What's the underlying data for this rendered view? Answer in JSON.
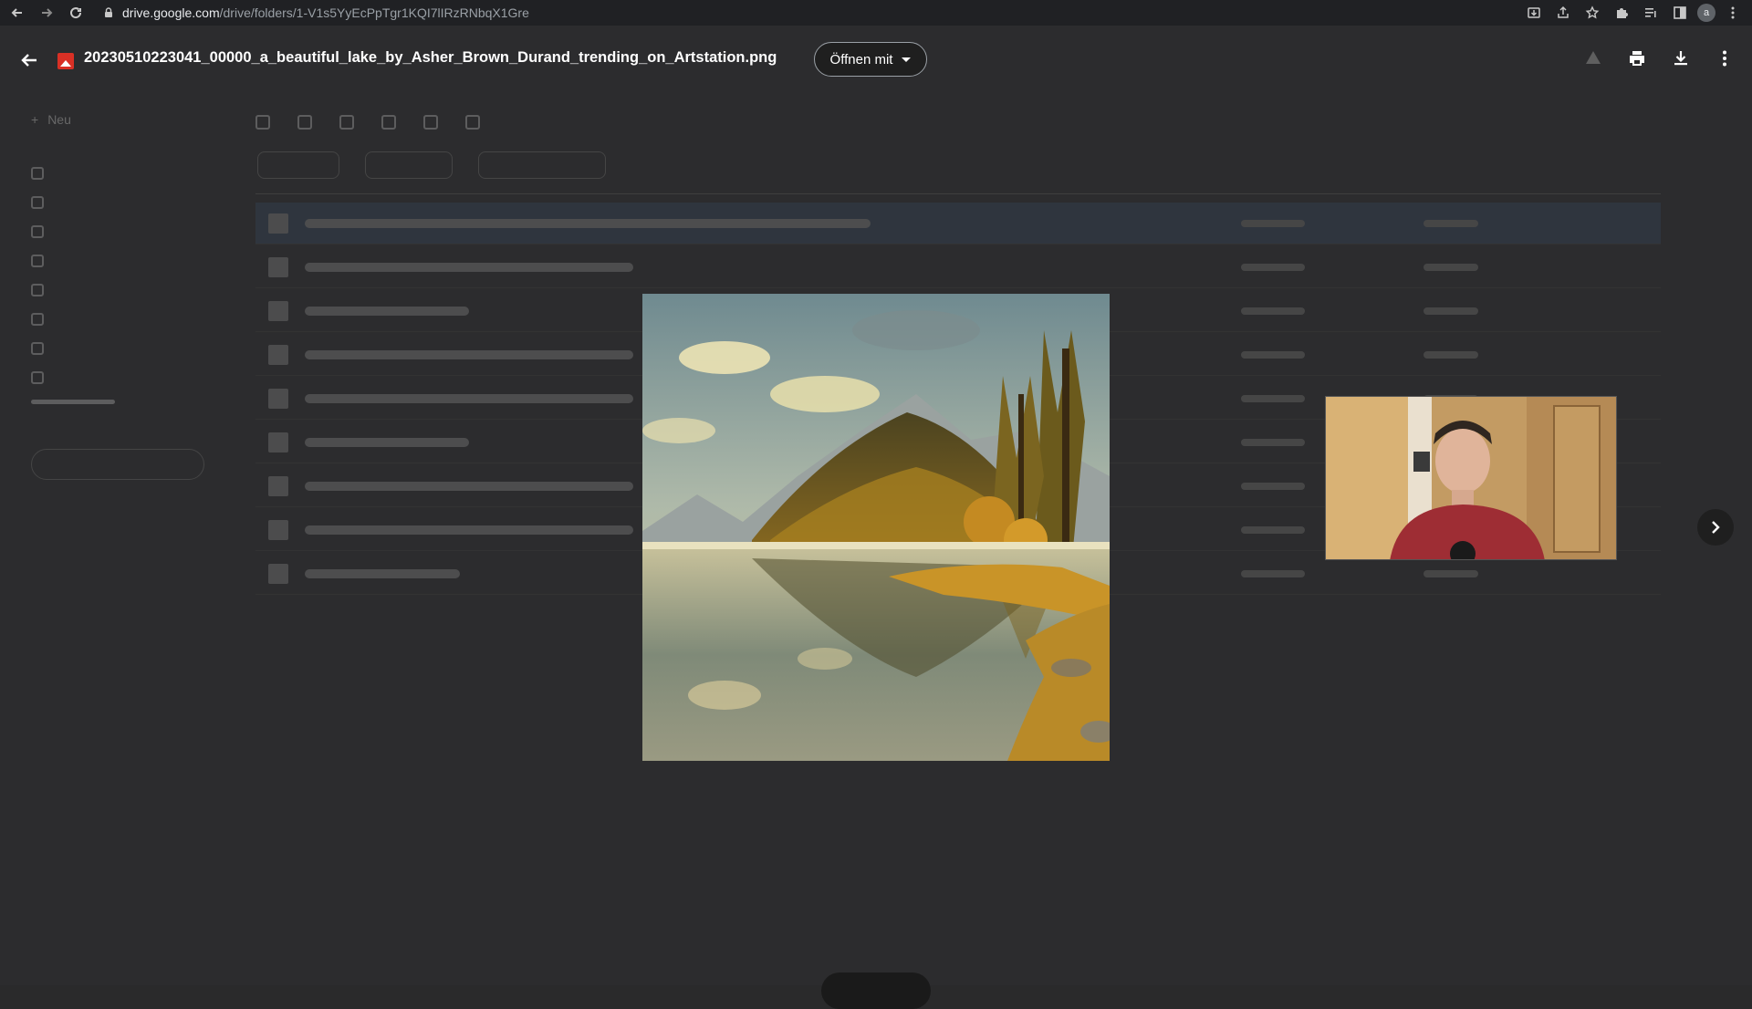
{
  "browser": {
    "url_host": "drive.google.com",
    "url_path": "/drive/folders/1-V1s5YyEcPpTgr1KQI7lIRzRNbqX1Gre",
    "profile_initial": "a"
  },
  "viewer": {
    "file_title": "20230510223041_00000_a_beautiful_lake_by_Asher_Brown_Durand_trending_on_Artstation.png",
    "open_with_label": "Öffnen mit"
  },
  "drive_background": {
    "new_label": "Neu",
    "file_rows": 9
  },
  "colors": {
    "file_icon": "#d93025",
    "accent_selected_row": "#3a4a63"
  },
  "icons": {
    "back": "arrow-left-icon",
    "print": "printer-icon",
    "download": "download-icon",
    "more": "more-vert-icon",
    "next": "chevron-right-icon"
  }
}
